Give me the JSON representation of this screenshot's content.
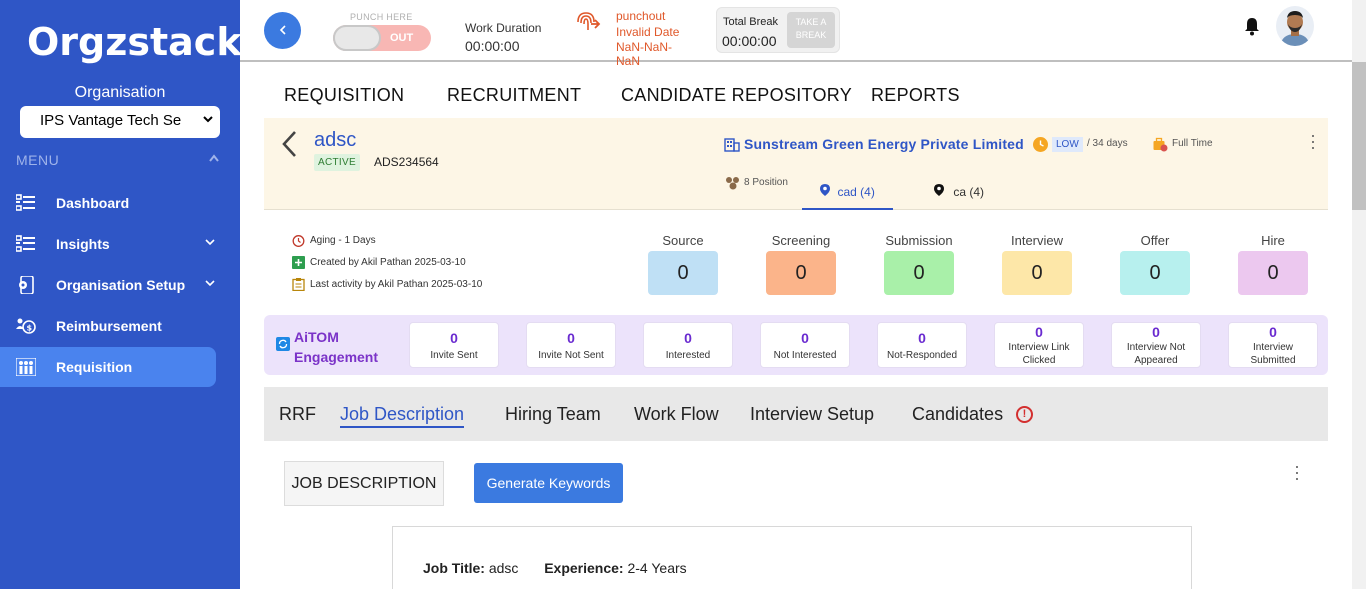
{
  "app": {
    "logo_text": "Orgzstack"
  },
  "sidebar": {
    "org_label": "Organisation",
    "org_selected": "IPS Vantage Tech Se",
    "menu_label": "MENU",
    "items": [
      {
        "label": "Dashboard",
        "icon": "list-icon"
      },
      {
        "label": "Insights",
        "icon": "list-icon"
      },
      {
        "label": "Organisation Setup",
        "icon": "device-gear-icon"
      },
      {
        "label": "Reimbursement",
        "icon": "money-people-icon"
      },
      {
        "label": "Requisition",
        "icon": "people-icon"
      }
    ]
  },
  "topbar": {
    "punch_label": "PUNCH HERE",
    "punch_state": "OUT",
    "work_duration_label": "Work Duration",
    "work_duration_value": "00:00:00",
    "punchout_lines": [
      "punchout",
      "Invalid Date",
      "NaN-NaN-",
      "NaN"
    ],
    "total_break_label": "Total Break",
    "total_break_value": "00:00:00",
    "take_break_line1": "TAKE A",
    "take_break_line2": "BREAK"
  },
  "main_nav": [
    "REQUISITION",
    "RECRUITMENT",
    "CANDIDATE REPOSITORY",
    "REPORTS"
  ],
  "requisition": {
    "name": "adsc",
    "status": "ACTIVE",
    "code": "ADS234564",
    "company": "Sunstream Green Energy Private Limited",
    "priority": "LOW",
    "days": "/ 34 days",
    "employment_type": "Full Time",
    "positions": "8 Position",
    "locations": [
      {
        "label": "cad (4)",
        "active": true
      },
      {
        "label": "ca (4)",
        "active": false
      }
    ]
  },
  "stats": {
    "aging": "Aging - 1 Days",
    "created": "Created by Akil Pathan 2025-03-10",
    "last_activity": "Last activity by Akil Pathan 2025-03-10",
    "stages": [
      {
        "label": "Source",
        "value": "0",
        "color": "#bfe0f5"
      },
      {
        "label": "Screening",
        "value": "0",
        "color": "#fbb48a"
      },
      {
        "label": "Submission",
        "value": "0",
        "color": "#a9f0a9"
      },
      {
        "label": "Interview",
        "value": "0",
        "color": "#fde7a8"
      },
      {
        "label": "Offer",
        "value": "0",
        "color": "#b7f0ee"
      },
      {
        "label": "Hire",
        "value": "0",
        "color": "#ecc8ef"
      }
    ]
  },
  "aitom": {
    "title_line1": "AiTOM",
    "title_line2": "Engagement",
    "cards": [
      {
        "value": "0",
        "label": "Invite Sent"
      },
      {
        "value": "0",
        "label": "Invite Not Sent"
      },
      {
        "value": "0",
        "label": "Interested"
      },
      {
        "value": "0",
        "label": "Not Interested"
      },
      {
        "value": "0",
        "label": "Not-Responded"
      },
      {
        "value": "0",
        "label_line1": "Interview Link",
        "label_line2": "Clicked"
      },
      {
        "value": "0",
        "label_line1": "Interview Not",
        "label_line2": "Appeared"
      },
      {
        "value": "0",
        "label_line1": "Interview",
        "label_line2": "Submitted"
      }
    ]
  },
  "subtabs": [
    "RRF",
    "Job Description",
    "Hiring Team",
    "Work Flow",
    "Interview Setup",
    "Candidates"
  ],
  "jd": {
    "section_label": "JOB DESCRIPTION",
    "generate_label": "Generate Keywords",
    "job_title_label": "Job Title:",
    "job_title_value": "adsc",
    "experience_label": "Experience:",
    "experience_value": "2-4 Years"
  }
}
